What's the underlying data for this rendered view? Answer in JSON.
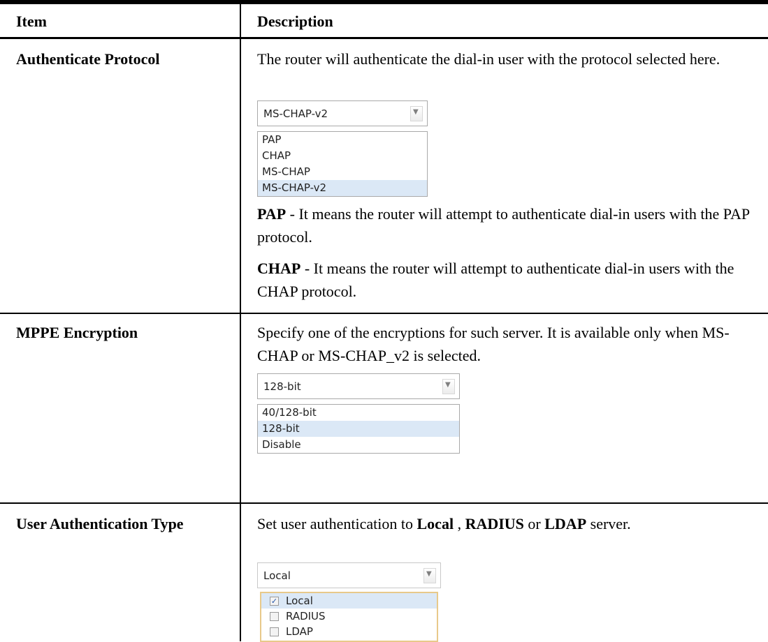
{
  "table": {
    "headers": {
      "item": "Item",
      "description": "Description"
    },
    "rows": [
      {
        "item": "Authenticate Protocol",
        "intro": "The router will authenticate the dial-in user with the protocol selected here.",
        "select_value": "MS-CHAP-v2",
        "options": [
          "PAP",
          "CHAP",
          "MS-CHAP",
          "MS-CHAP-v2"
        ],
        "selected_option": "MS-CHAP-v2",
        "notes": [
          {
            "term": "PAP",
            "text": " - It means the router will attempt to authenticate dial-in users with the PAP protocol."
          },
          {
            "term": "CHAP",
            "text": " - It means the router will attempt to authenticate dial-in users with the CHAP protocol."
          }
        ]
      },
      {
        "item": "MPPE Encryption",
        "intro": "Specify one of the encryptions for such server. It is available only when MS-CHAP or MS-CHAP_v2 is selected.",
        "select_value": "128-bit",
        "options": [
          "40/128-bit",
          "128-bit",
          "Disable"
        ],
        "selected_option": "128-bit"
      },
      {
        "item": "User Authentication Type",
        "intro_parts": [
          "Set user authentication to ",
          "Local",
          " , ",
          "RADIUS",
          " or ",
          "LDAP",
          " server."
        ],
        "select_value": "Local",
        "checkbox_options": [
          {
            "label": "Local",
            "checked": true
          },
          {
            "label": "RADIUS",
            "checked": false
          },
          {
            "label": "LDAP",
            "checked": false
          }
        ]
      }
    ]
  },
  "icons": {
    "dropdown": "chevron-down-icon",
    "check": "check-mark-icon"
  }
}
